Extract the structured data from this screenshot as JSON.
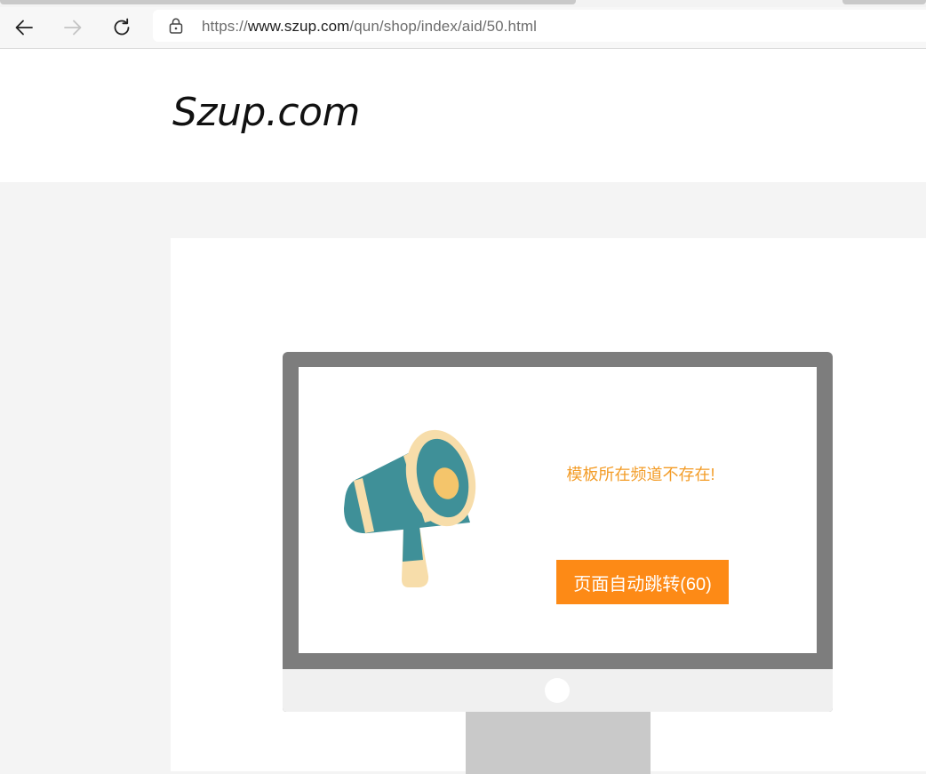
{
  "browser": {
    "url_prefix": "https://",
    "url_host": "www.szup.com",
    "url_path": "/qun/shop/index/aid/50.html",
    "icons": {
      "back": "arrow-left-icon",
      "forward": "arrow-right-icon",
      "reload": "refresh-icon",
      "security": "lock-icon"
    }
  },
  "header": {
    "logo_text": "Szup.com"
  },
  "notice": {
    "message": "模板所在频道不存在!",
    "redirect_button": "页面自动跳转(60)",
    "illustration": "megaphone-icon"
  },
  "colors": {
    "accent": "#fd8a16",
    "message": "#f39c27",
    "monitor_frame": "#7d7d7d",
    "megaphone_teal": "#3f9098",
    "megaphone_cream": "#f7ddaa",
    "megaphone_yellow": "#f4c56b"
  }
}
